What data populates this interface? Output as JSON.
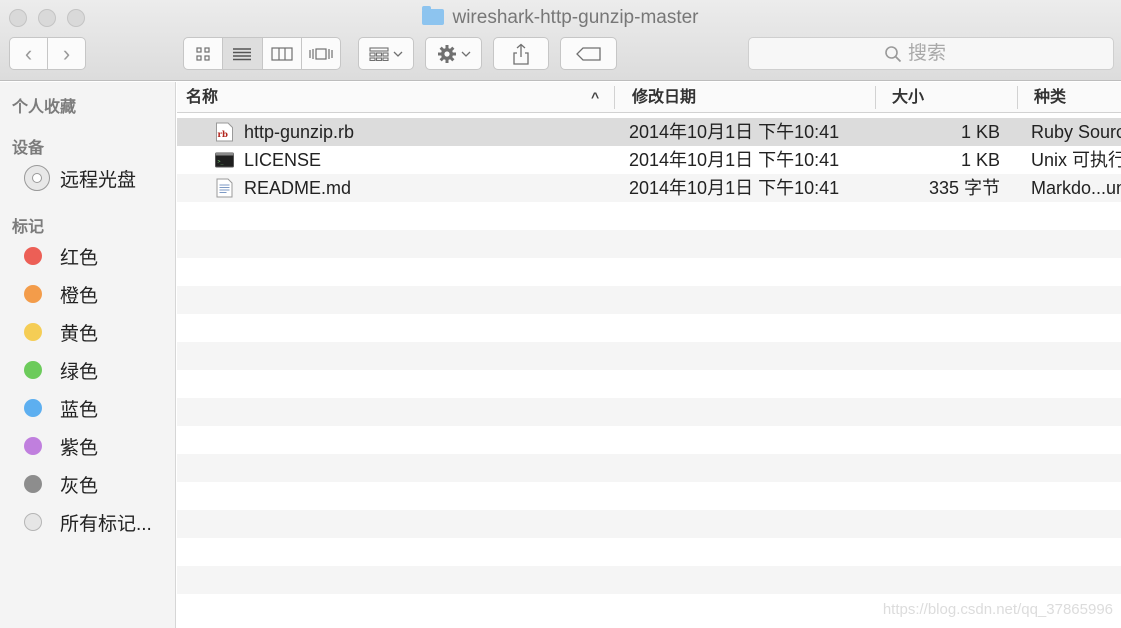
{
  "window": {
    "title": "wireshark-http-gunzip-master"
  },
  "toolbar": {
    "back_label": "‹",
    "forward_label": "›",
    "search_placeholder": "搜索"
  },
  "sidebar": {
    "favorites_header": "个人收藏",
    "devices_header": "设备",
    "devices": [
      {
        "label": "远程光盘",
        "icon": "disc-icon"
      }
    ],
    "tags_header": "标记",
    "tags": [
      {
        "label": "红色",
        "color": "#ec5f56"
      },
      {
        "label": "橙色",
        "color": "#f39c4a"
      },
      {
        "label": "黄色",
        "color": "#f5cd55"
      },
      {
        "label": "绿色",
        "color": "#6ccb5b"
      },
      {
        "label": "蓝色",
        "color": "#5daff0"
      },
      {
        "label": "紫色",
        "color": "#c07fde"
      },
      {
        "label": "灰色",
        "color": "#8d8d8d"
      },
      {
        "label": "所有标记...",
        "color": "#e6e6e6"
      }
    ]
  },
  "columns": {
    "name": "名称",
    "date": "修改日期",
    "size": "大小",
    "kind": "种类"
  },
  "files": [
    {
      "name": "http-gunzip.rb",
      "date": "2014年10月1日 下午10:41",
      "size": "1 KB",
      "kind": "Ruby Source",
      "icon": "ruby-file-icon",
      "selected": true
    },
    {
      "name": "LICENSE",
      "date": "2014年10月1日 下午10:41",
      "size": "1 KB",
      "kind": "Unix 可执行文件",
      "icon": "terminal-file-icon",
      "selected": false
    },
    {
      "name": "README.md",
      "date": "2014年10月1日 下午10:41",
      "size": "335 字节",
      "kind": "Markdo...ument",
      "icon": "text-file-icon",
      "selected": false
    }
  ],
  "watermark": "https://blog.csdn.net/qq_37865996"
}
